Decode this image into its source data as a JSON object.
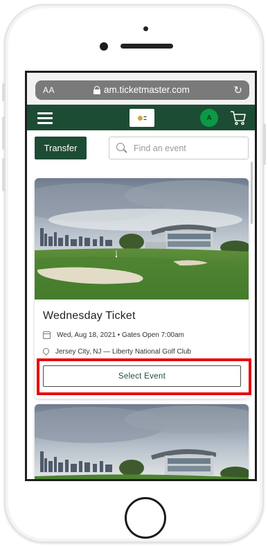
{
  "browser": {
    "text_size_label": "AA",
    "url": "am.ticketmaster.com"
  },
  "header": {
    "avatar_initial": "A",
    "brand_color": "#1d4c34"
  },
  "toolbar": {
    "transfer_label": "Transfer",
    "search_placeholder": "Find an event"
  },
  "events": [
    {
      "title": "Wednesday Ticket",
      "date_time": "Wed, Aug 18, 2021 • Gates Open 7:00am",
      "location": "Jersey City, NJ — Liberty National Golf Club",
      "action_label": "Select Event"
    }
  ],
  "highlight_color": "#e8000b"
}
